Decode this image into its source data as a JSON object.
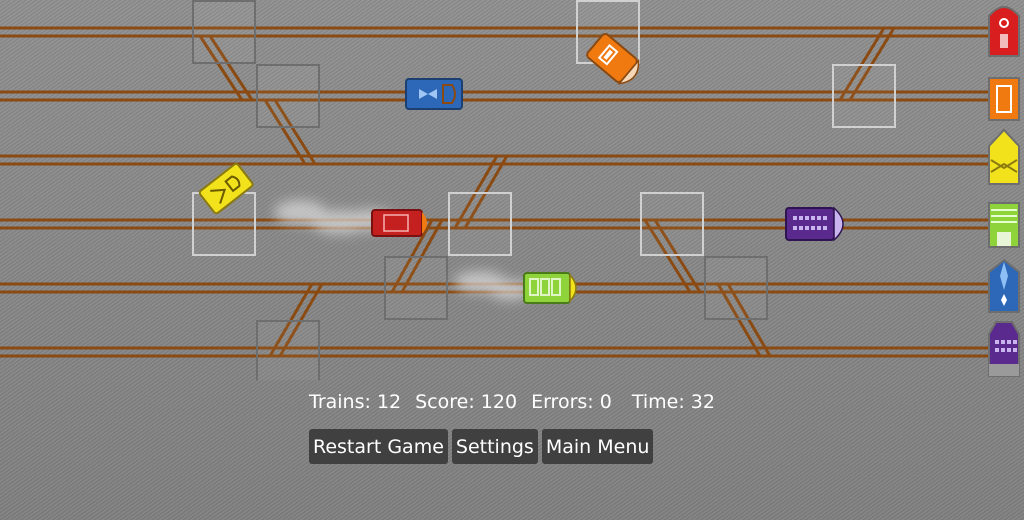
{
  "hud": {
    "trains_label": "Trains:",
    "trains": 12,
    "score_label": "Score:",
    "score": 120,
    "errors_label": "Errors:",
    "errors": 0,
    "time_label": "Time:",
    "time": 32
  },
  "buttons": {
    "restart": "Restart Game",
    "settings": "Settings",
    "main_menu": "Main Menu"
  },
  "colors": {
    "track": "#8a4a12",
    "switch_active": "#d0d0d0",
    "switch_inactive": "#6e6e6e",
    "hud_text": "#ffffff",
    "button_bg": "#404040"
  },
  "stations": [
    {
      "name": "red-station",
      "color": "#d81e1e"
    },
    {
      "name": "orange-station",
      "color": "#f07a10"
    },
    {
      "name": "yellow-station",
      "color": "#f2e21c"
    },
    {
      "name": "green-station",
      "color": "#8ed33a"
    },
    {
      "name": "blue-station",
      "color": "#2c67b8"
    },
    {
      "name": "purple-station",
      "color": "#5a2a8e"
    }
  ],
  "trains": [
    {
      "name": "blue-train",
      "color": "#2c67b8"
    },
    {
      "name": "orange-train",
      "color": "#f07a10"
    },
    {
      "name": "yellow-train",
      "color": "#f2e21c"
    },
    {
      "name": "red-train",
      "color": "#d81e1e"
    },
    {
      "name": "green-train",
      "color": "#8ed33a"
    },
    {
      "name": "purple-train",
      "color": "#5a2a8e"
    }
  ]
}
